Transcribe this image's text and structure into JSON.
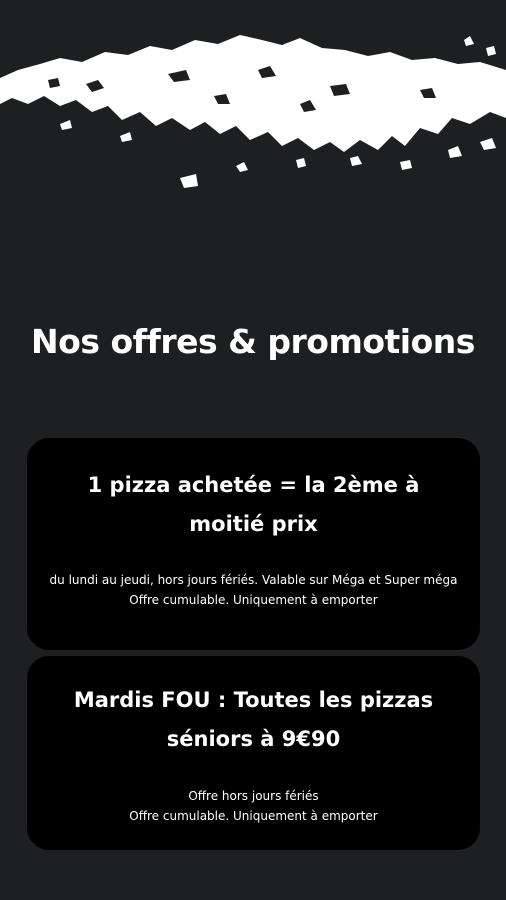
{
  "page": {
    "title": "Nos offres & promotions",
    "background_color": "#1d1f21",
    "card_color": "#000000",
    "header_decoration": "white-brush-stroke"
  },
  "offers": [
    {
      "title": "1 pizza achetée = la 2ème à moitié prix",
      "description_lines": [
        "du lundi au jeudi, hors jours fériés. Valable sur Méga et Super méga",
        "Offre cumulable. Uniquement à emporter"
      ]
    },
    {
      "title": "Mardis FOU : Toutes les pizzas séniors à 9€90",
      "description_lines": [
        "Offre hors jours fériés",
        "Offre cumulable. Uniquement à emporter"
      ]
    }
  ]
}
